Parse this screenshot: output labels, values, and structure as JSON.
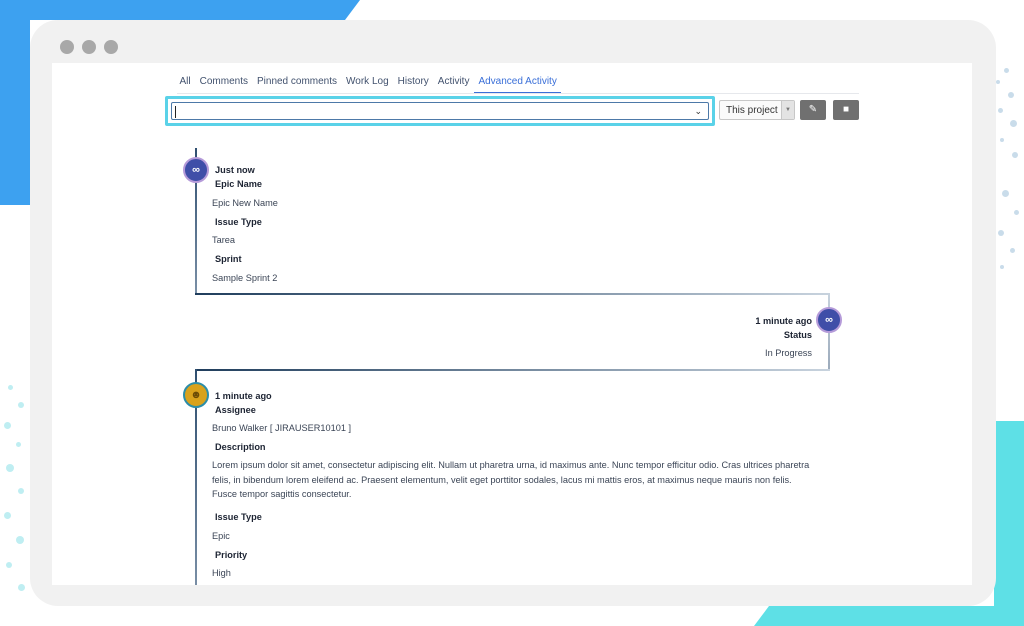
{
  "tabs": {
    "all": "All",
    "comments": "Comments",
    "pinned": "Pinned comments",
    "worklog": "Work Log",
    "history": "History",
    "activity": "Activity",
    "advanced": "Advanced Activity"
  },
  "filter": {
    "search_value": "",
    "scope_label": "This project"
  },
  "entries": [
    {
      "time": "Just now",
      "avatar_icon": "infinity-avatar-icon",
      "fields": [
        {
          "label": "Epic Name",
          "value": "Epic New Name"
        },
        {
          "label": "Issue Type",
          "value": "Tarea"
        },
        {
          "label": "Sprint",
          "value": "Sample Sprint 2"
        }
      ]
    },
    {
      "time": "1 minute ago",
      "avatar_icon": "infinity-avatar-icon",
      "fields": [
        {
          "label": "Status",
          "value": "In Progress"
        }
      ]
    },
    {
      "time": "1 minute ago",
      "avatar_icon": "user-avatar-icon",
      "fields": [
        {
          "label": "Assignee",
          "value": "Bruno Walker [ JIRAUSER10101 ]"
        },
        {
          "label": "Description",
          "value": "Lorem ipsum dolor sit amet, consectetur adipiscing elit. Nullam ut pharetra urna, id maximus ante. Nunc tempor efficitur odio. Cras ultrices pharetra felis, in bibendum lorem eleifend ac. Praesent elementum, velit eget porttitor sodales, lacus mi mattis eros, at maximus neque mauris non felis. Fusce tempor sagittis consectetur."
        },
        {
          "label": "Issue Type",
          "value": "Epic"
        },
        {
          "label": "Priority",
          "value": "High"
        }
      ]
    }
  ],
  "colors": {
    "accent": "#3a6fd8",
    "focus_ring": "#5ad2e8",
    "bg_blue": "#3da1f0",
    "bg_teal": "#5ee0e6"
  }
}
